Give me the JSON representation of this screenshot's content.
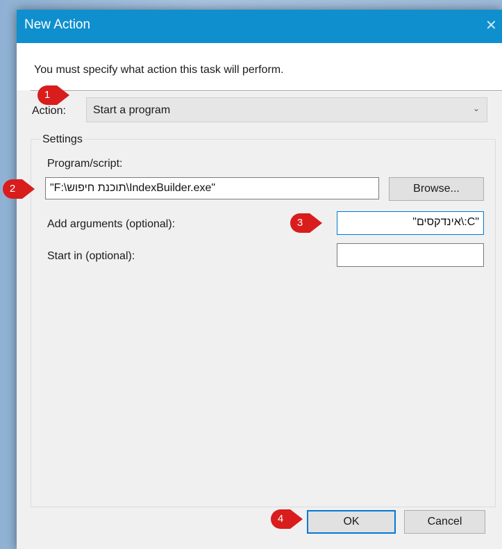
{
  "window": {
    "title": "New Action",
    "close_glyph": "✕",
    "header_text": "You must specify what action this task will perform."
  },
  "action": {
    "label": "Action:",
    "selected": "Start a program",
    "arrow_icon": "chevron-down-icon"
  },
  "settings": {
    "group_title": "Settings",
    "program_label": "Program/script:",
    "program_value": "\"F:\\תוכנת חיפוש\\IndexBuilder.exe\"",
    "browse_label": "Browse...",
    "arguments_label": "Add arguments (optional):",
    "arguments_value": "\"C:\\אינדקסים\"",
    "startin_label": "Start in (optional):",
    "startin_value": ""
  },
  "buttons": {
    "ok": "OK",
    "cancel": "Cancel"
  },
  "markers": {
    "m1": "1",
    "m2": "2",
    "m3": "3",
    "m4": "4",
    "color": "#d91c1c"
  },
  "colors": {
    "titlebar": "#0f8fcd",
    "focus": "#0078d7"
  }
}
